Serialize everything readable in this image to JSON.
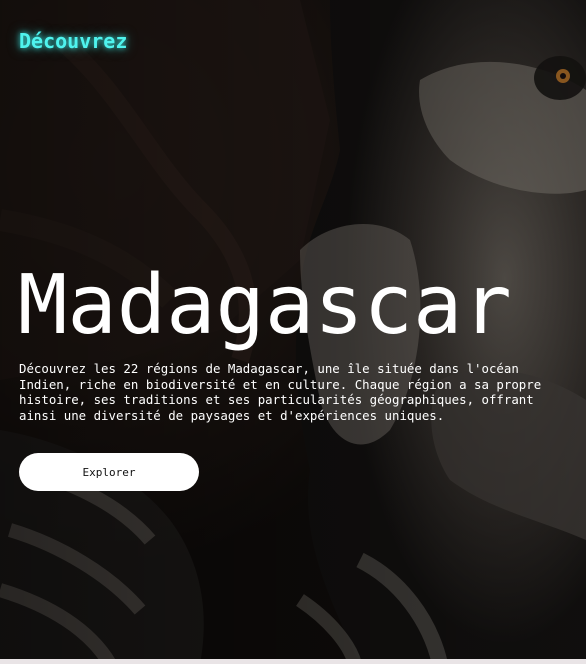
{
  "header": {
    "brand": "Découvrez"
  },
  "hero": {
    "title": "Madagascar",
    "description": "Découvrez les 22 régions de Madagascar, une île située dans l'océan\nIndien, riche en biodiversité et en culture. Chaque région a sa propre\nhistoire, ses traditions et ses particularités géographiques, offrant\nainsi une diversité de paysages et d'expériences uniques.",
    "cta_label": "Explorer"
  },
  "colors": {
    "brand_accent": "#4ff3ee",
    "text": "#ffffff",
    "button_bg": "#ffffff",
    "overlay": "#000000"
  },
  "background_image": "ring-tailed-lemur-photo"
}
